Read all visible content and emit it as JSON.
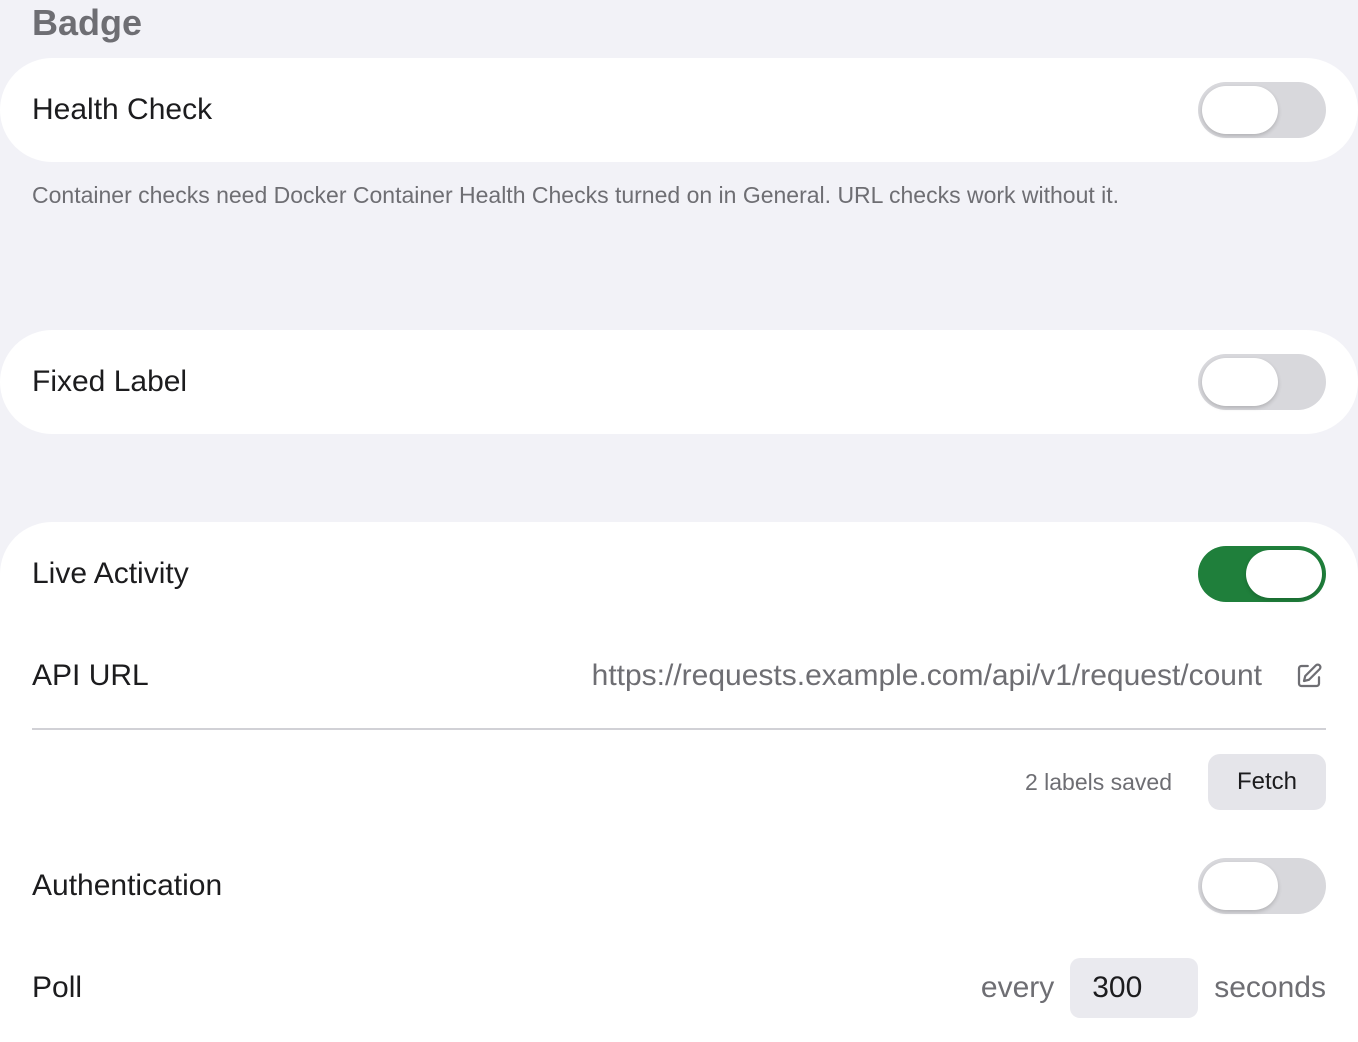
{
  "section": {
    "title": "Badge"
  },
  "health_check": {
    "label": "Health Check",
    "enabled": false,
    "footnote": "Container checks need Docker Container Health Checks turned on in General. URL checks work without it."
  },
  "fixed_label": {
    "label": "Fixed Label",
    "enabled": false
  },
  "live_activity": {
    "label": "Live Activity",
    "enabled": true,
    "api_url_label": "API URL",
    "api_url_value": "https://requests.example.com/api/v1/request/count",
    "labels_saved": "2 labels saved",
    "fetch_label": "Fetch",
    "authentication_label": "Authentication",
    "authentication_enabled": false,
    "poll_label": "Poll",
    "poll_prefix": "every",
    "poll_value": "300",
    "poll_suffix": "seconds"
  },
  "colors": {
    "toggle_on": "#1f7f3b",
    "toggle_off": "#d8d8dc",
    "background": "#f2f2f7"
  },
  "icons": {
    "edit": "edit-pencil-icon"
  }
}
